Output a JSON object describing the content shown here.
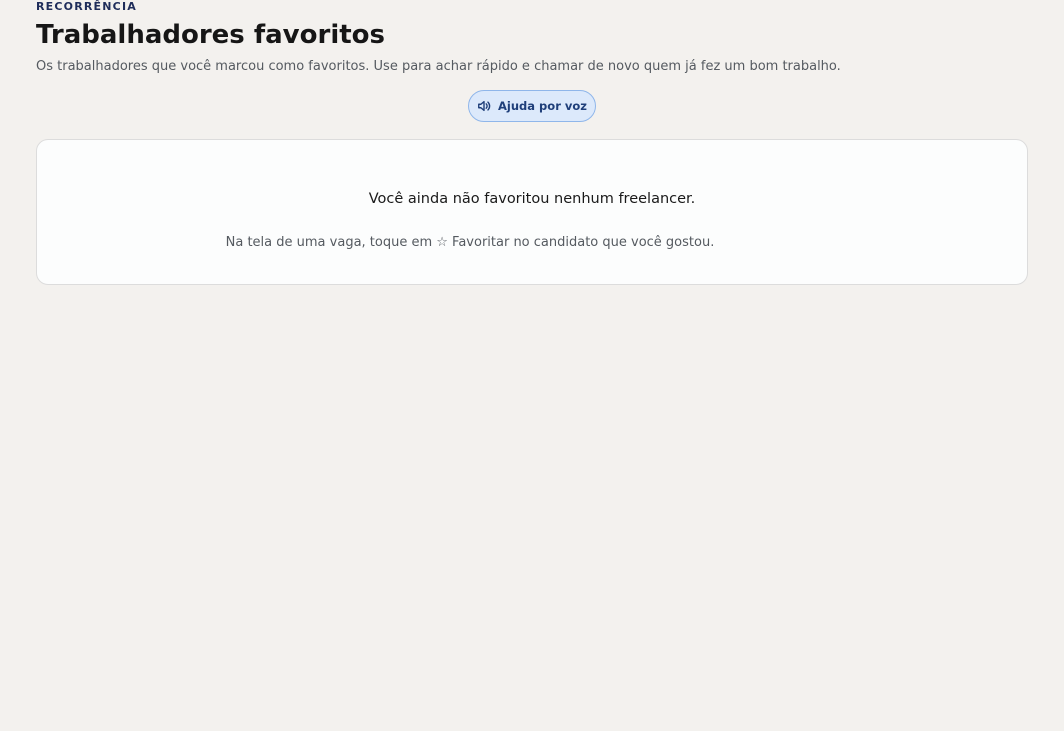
{
  "header": {
    "eyebrow": "RECORRÊNCIA",
    "title": "Trabalhadores favoritos",
    "subtitle": "Os trabalhadores que você marcou como favoritos. Use para achar rápido e chamar de novo quem já fez um bom trabalho."
  },
  "voice_help": {
    "label": "Ajuda por voz",
    "icon": "speaker-icon"
  },
  "empty_state": {
    "title": "Você ainda não favoritou nenhum freelancer.",
    "hint": "Na tela de uma vaga, toque em ☆ Favoritar no candidato que você gostou."
  },
  "colors": {
    "background": "#f3f1ee",
    "card": "#fcfdfd",
    "eyebrow": "#1f2d5a",
    "voice_button_bg": "#dce9fb",
    "voice_button_text": "#1f3f7a"
  }
}
